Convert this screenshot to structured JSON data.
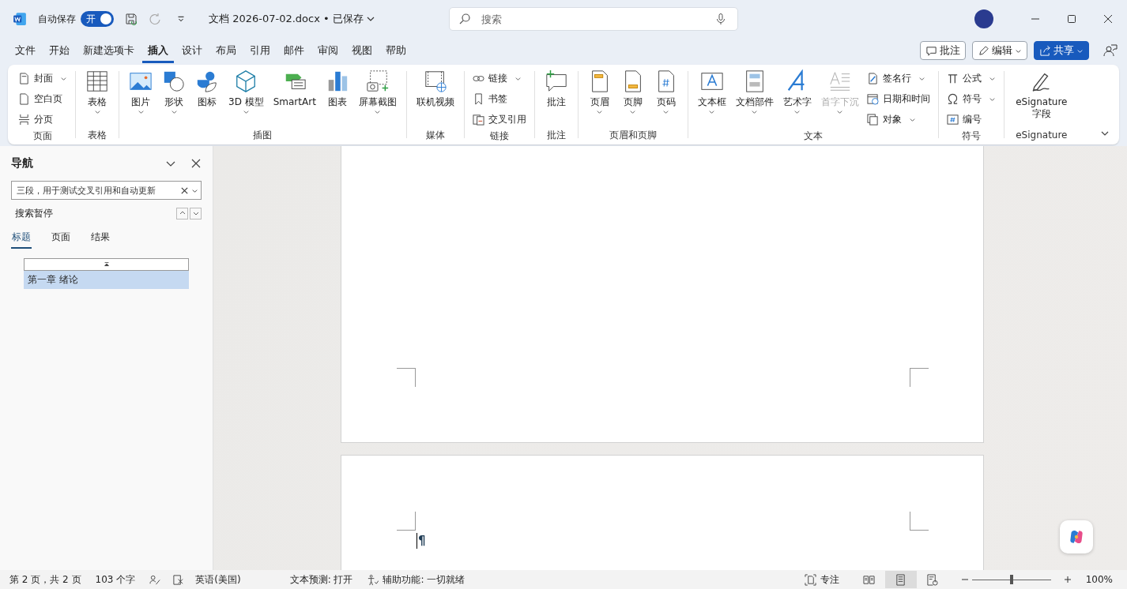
{
  "title_bar": {
    "autosave_label": "自动保存",
    "autosave_toggle": {
      "label": "开",
      "on": true
    },
    "document_title": "文档 2026-07-02.docx • 已保存",
    "search": {
      "placeholder": "搜索"
    }
  },
  "menu_tabs": [
    {
      "label": "文件",
      "selected": false
    },
    {
      "label": "开始",
      "selected": false
    },
    {
      "label": "新建选项卡",
      "selected": false
    },
    {
      "label": "插入",
      "selected": true
    },
    {
      "label": "设计",
      "selected": false
    },
    {
      "label": "布局",
      "selected": false
    },
    {
      "label": "引用",
      "selected": false
    },
    {
      "label": "邮件",
      "selected": false
    },
    {
      "label": "审阅",
      "selected": false
    },
    {
      "label": "视图",
      "selected": false
    },
    {
      "label": "帮助",
      "selected": false
    }
  ],
  "actions": {
    "comments": "批注",
    "editing": "编辑",
    "share": "共享"
  },
  "ribbon": [
    {
      "label": "页面",
      "items": [
        {
          "kind": "small",
          "label": "封面",
          "dropdown": true,
          "disabled": false
        },
        {
          "kind": "small",
          "label": "空白页",
          "dropdown": false,
          "disabled": false
        },
        {
          "kind": "small",
          "label": "分页",
          "dropdown": false,
          "disabled": false
        }
      ]
    },
    {
      "label": "表格",
      "items": [
        {
          "kind": "large",
          "label": "表格",
          "dropdown": true,
          "disabled": false
        }
      ]
    },
    {
      "label": "插图",
      "items": [
        {
          "kind": "large",
          "label": "图片",
          "dropdown": true,
          "disabled": false
        },
        {
          "kind": "large",
          "label": "形状",
          "dropdown": true,
          "disabled": false
        },
        {
          "kind": "large",
          "label": "图标",
          "dropdown": false,
          "disabled": false
        },
        {
          "kind": "large",
          "label": "3D 模型",
          "dropdown": true,
          "disabled": false
        },
        {
          "kind": "large",
          "label": "SmartArt",
          "dropdown": false,
          "disabled": false
        },
        {
          "kind": "large",
          "label": "图表",
          "dropdown": false,
          "disabled": false
        },
        {
          "kind": "large",
          "label": "屏幕截图",
          "dropdown": true,
          "disabled": false
        }
      ]
    },
    {
      "label": "媒体",
      "items": [
        {
          "kind": "large",
          "label": "联机视频",
          "dropdown": false,
          "disabled": false
        }
      ]
    },
    {
      "label": "链接",
      "items": [
        {
          "kind": "small",
          "label": "链接",
          "dropdown": true,
          "disabled": false
        },
        {
          "kind": "small",
          "label": "书签",
          "dropdown": false,
          "disabled": false
        },
        {
          "kind": "small",
          "label": "交叉引用",
          "dropdown": false,
          "disabled": false
        }
      ]
    },
    {
      "label": "批注",
      "items": [
        {
          "kind": "large",
          "label": "批注",
          "dropdown": false,
          "disabled": false
        }
      ]
    },
    {
      "label": "页眉和页脚",
      "items": [
        {
          "kind": "large",
          "label": "页眉",
          "dropdown": true,
          "disabled": false
        },
        {
          "kind": "large",
          "label": "页脚",
          "dropdown": true,
          "disabled": false
        },
        {
          "kind": "large",
          "label": "页码",
          "dropdown": true,
          "disabled": false
        }
      ]
    },
    {
      "label": "文本",
      "items": [
        {
          "kind": "large",
          "label": "文本框",
          "dropdown": true,
          "disabled": false
        },
        {
          "kind": "large",
          "label": "文档部件",
          "dropdown": true,
          "disabled": false
        },
        {
          "kind": "large",
          "label": "艺术字",
          "dropdown": true,
          "disabled": false
        },
        {
          "kind": "large",
          "label": "首字下沉",
          "dropdown": true,
          "disabled": true
        },
        {
          "kind": "small",
          "label": "签名行",
          "dropdown": true,
          "disabled": false
        },
        {
          "kind": "small",
          "label": "日期和时间",
          "dropdown": false,
          "disabled": false
        },
        {
          "kind": "small",
          "label": "对象",
          "dropdown": true,
          "disabled": false
        }
      ]
    },
    {
      "label": "符号",
      "items": [
        {
          "kind": "small",
          "label": "公式",
          "dropdown": true,
          "disabled": false
        },
        {
          "kind": "small",
          "label": "符号",
          "dropdown": true,
          "disabled": false
        },
        {
          "kind": "small",
          "label": "编号",
          "dropdown": false,
          "disabled": false
        }
      ]
    },
    {
      "label": "eSignature",
      "items": [
        {
          "kind": "large",
          "label": "eSignature 字段",
          "dropdown": false,
          "disabled": false
        }
      ]
    }
  ],
  "navigation": {
    "title": "导航",
    "search_value": "三段，用于测试交叉引用和自动更新",
    "search_status": "搜索暂停",
    "tabs": [
      {
        "label": "标题",
        "selected": true
      },
      {
        "label": "页面",
        "selected": false
      },
      {
        "label": "结果",
        "selected": false
      }
    ],
    "headings": [
      {
        "label": "第一章 绪论",
        "selected": true
      }
    ]
  },
  "document": {
    "paragraph_mark": "¶"
  },
  "status_bar": {
    "page": "第 2 页，共 2 页",
    "word_count": "103 个字",
    "language": "英语(美国)",
    "text_prediction": "文本预测: 打开",
    "accessibility": "辅助功能: 一切就绪",
    "focus": "专注",
    "views": [
      {
        "selected": false
      },
      {
        "selected": true
      },
      {
        "selected": false
      }
    ],
    "zoom": {
      "level": 0.5,
      "reading": "100%"
    }
  }
}
